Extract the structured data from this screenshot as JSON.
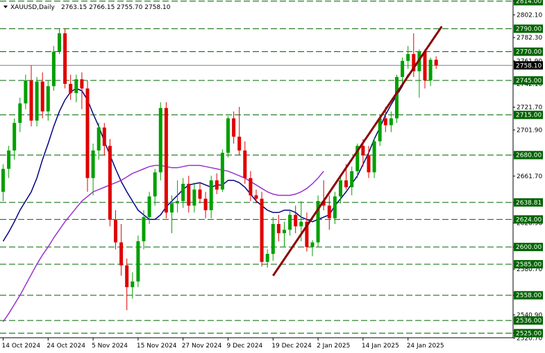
{
  "header": {
    "symbol_label": "XAUUSD,Daily",
    "ohlc_label": "2763.15 2766.15 2755.70 2758.10"
  },
  "chart_data": {
    "type": "candlestick",
    "symbol": "XAUUSD",
    "timeframe": "Daily",
    "ylim": [
      2521,
      2815
    ],
    "grid": false,
    "colors": {
      "bull": "#00a000",
      "bear": "#e00000",
      "ma_fast": "#000080",
      "ma_slow": "#9932cc",
      "trendline": "#8b0000",
      "level_line": "#006400",
      "price_line": "#708090",
      "level_label_bg": "#006400",
      "price_label_bg": "#000000"
    },
    "y_ticks": [
      "2814.00",
      "2802.10",
      "2782.30",
      "2761.90",
      "2742.10",
      "2721.70",
      "2701.90",
      "2680.00",
      "2661.70",
      "2638.81",
      "2620.90",
      "2600.00",
      "2580.70",
      "2558.00",
      "2540.90",
      "2525.00",
      "2520.70"
    ],
    "levels": [
      2814.0,
      2790.0,
      2770.0,
      2745.0,
      2715.0,
      2680.0,
      2638.81,
      2624.0,
      2600.0,
      2585.0,
      2558.0,
      2536.0,
      2525.0
    ],
    "level_labels": [
      "2814.00",
      "2790.00",
      "2770.00",
      "2745.00",
      "2715.00",
      "2680.00",
      "2638.81",
      "2624.00",
      "2600.00",
      "2585.00",
      "2558.00",
      "2536.00",
      "2525.00"
    ],
    "current_price": 2758.1,
    "current_price_label": "2758.10",
    "x_labels": [
      "14 Oct 2024",
      "24 Oct 2024",
      "5 Nov 2024",
      "15 Nov 2024",
      "27 Nov 2024",
      "9 Dec 2024",
      "19 Dec 2024",
      "2 Jan 2025",
      "14 Jan 2025",
      "24 Jan 2025"
    ],
    "x_label_index": [
      0,
      8,
      16,
      24,
      32,
      40,
      48,
      56,
      64,
      72
    ],
    "candles": [
      {
        "o": 2648,
        "h": 2672,
        "l": 2640,
        "c": 2668
      },
      {
        "o": 2668,
        "h": 2688,
        "l": 2660,
        "c": 2684
      },
      {
        "o": 2684,
        "h": 2712,
        "l": 2676,
        "c": 2708
      },
      {
        "o": 2708,
        "h": 2730,
        "l": 2700,
        "c": 2725
      },
      {
        "o": 2725,
        "h": 2750,
        "l": 2720,
        "c": 2745
      },
      {
        "o": 2745,
        "h": 2758,
        "l": 2705,
        "c": 2710
      },
      {
        "o": 2710,
        "h": 2748,
        "l": 2705,
        "c": 2744
      },
      {
        "o": 2744,
        "h": 2752,
        "l": 2712,
        "c": 2718
      },
      {
        "o": 2718,
        "h": 2745,
        "l": 2710,
        "c": 2740
      },
      {
        "o": 2740,
        "h": 2775,
        "l": 2736,
        "c": 2770
      },
      {
        "o": 2770,
        "h": 2790,
        "l": 2768,
        "c": 2786
      },
      {
        "o": 2786,
        "h": 2790,
        "l": 2738,
        "c": 2742
      },
      {
        "o": 2742,
        "h": 2750,
        "l": 2728,
        "c": 2734
      },
      {
        "o": 2734,
        "h": 2750,
        "l": 2726,
        "c": 2746
      },
      {
        "o": 2746,
        "h": 2752,
        "l": 2720,
        "c": 2738
      },
      {
        "o": 2738,
        "h": 2745,
        "l": 2648,
        "c": 2660
      },
      {
        "o": 2660,
        "h": 2690,
        "l": 2645,
        "c": 2684
      },
      {
        "o": 2684,
        "h": 2708,
        "l": 2676,
        "c": 2704
      },
      {
        "o": 2704,
        "h": 2708,
        "l": 2680,
        "c": 2688
      },
      {
        "o": 2688,
        "h": 2694,
        "l": 2618,
        "c": 2624
      },
      {
        "o": 2624,
        "h": 2632,
        "l": 2598,
        "c": 2604
      },
      {
        "o": 2604,
        "h": 2620,
        "l": 2575,
        "c": 2584
      },
      {
        "o": 2584,
        "h": 2590,
        "l": 2545,
        "c": 2565
      },
      {
        "o": 2565,
        "h": 2578,
        "l": 2555,
        "c": 2570
      },
      {
        "o": 2570,
        "h": 2610,
        "l": 2565,
        "c": 2605
      },
      {
        "o": 2605,
        "h": 2632,
        "l": 2598,
        "c": 2626
      },
      {
        "o": 2626,
        "h": 2648,
        "l": 2620,
        "c": 2644
      },
      {
        "o": 2644,
        "h": 2668,
        "l": 2636,
        "c": 2665
      },
      {
        "o": 2665,
        "h": 2726,
        "l": 2658,
        "c": 2721
      },
      {
        "o": 2721,
        "h": 2726,
        "l": 2625,
        "c": 2630
      },
      {
        "o": 2630,
        "h": 2645,
        "l": 2612,
        "c": 2638
      },
      {
        "o": 2638,
        "h": 2658,
        "l": 2630,
        "c": 2640
      },
      {
        "o": 2640,
        "h": 2660,
        "l": 2634,
        "c": 2655
      },
      {
        "o": 2655,
        "h": 2662,
        "l": 2630,
        "c": 2636
      },
      {
        "o": 2636,
        "h": 2656,
        "l": 2630,
        "c": 2650
      },
      {
        "o": 2650,
        "h": 2656,
        "l": 2638,
        "c": 2642
      },
      {
        "o": 2642,
        "h": 2648,
        "l": 2625,
        "c": 2632
      },
      {
        "o": 2632,
        "h": 2662,
        "l": 2625,
        "c": 2658
      },
      {
        "o": 2658,
        "h": 2664,
        "l": 2646,
        "c": 2650
      },
      {
        "o": 2650,
        "h": 2685,
        "l": 2648,
        "c": 2682
      },
      {
        "o": 2682,
        "h": 2714,
        "l": 2678,
        "c": 2712
      },
      {
        "o": 2712,
        "h": 2718,
        "l": 2690,
        "c": 2696
      },
      {
        "o": 2696,
        "h": 2722,
        "l": 2680,
        "c": 2684
      },
      {
        "o": 2684,
        "h": 2692,
        "l": 2655,
        "c": 2660
      },
      {
        "o": 2660,
        "h": 2666,
        "l": 2640,
        "c": 2645
      },
      {
        "o": 2645,
        "h": 2650,
        "l": 2638,
        "c": 2642
      },
      {
        "o": 2642,
        "h": 2648,
        "l": 2583,
        "c": 2587
      },
      {
        "o": 2587,
        "h": 2598,
        "l": 2582,
        "c": 2594
      },
      {
        "o": 2594,
        "h": 2626,
        "l": 2588,
        "c": 2620
      },
      {
        "o": 2620,
        "h": 2628,
        "l": 2605,
        "c": 2612
      },
      {
        "o": 2612,
        "h": 2622,
        "l": 2600,
        "c": 2615
      },
      {
        "o": 2615,
        "h": 2632,
        "l": 2610,
        "c": 2628
      },
      {
        "o": 2628,
        "h": 2636,
        "l": 2612,
        "c": 2618
      },
      {
        "o": 2618,
        "h": 2640,
        "l": 2605,
        "c": 2622
      },
      {
        "o": 2622,
        "h": 2630,
        "l": 2596,
        "c": 2600
      },
      {
        "o": 2600,
        "h": 2606,
        "l": 2592,
        "c": 2604
      },
      {
        "o": 2604,
        "h": 2645,
        "l": 2600,
        "c": 2640
      },
      {
        "o": 2640,
        "h": 2658,
        "l": 2632,
        "c": 2636
      },
      {
        "o": 2636,
        "h": 2645,
        "l": 2615,
        "c": 2625
      },
      {
        "o": 2625,
        "h": 2648,
        "l": 2620,
        "c": 2644
      },
      {
        "o": 2644,
        "h": 2662,
        "l": 2638,
        "c": 2658
      },
      {
        "o": 2658,
        "h": 2672,
        "l": 2650,
        "c": 2652
      },
      {
        "o": 2652,
        "h": 2670,
        "l": 2645,
        "c": 2666
      },
      {
        "o": 2666,
        "h": 2690,
        "l": 2660,
        "c": 2688
      },
      {
        "o": 2688,
        "h": 2694,
        "l": 2670,
        "c": 2680
      },
      {
        "o": 2680,
        "h": 2688,
        "l": 2660,
        "c": 2665
      },
      {
        "o": 2665,
        "h": 2695,
        "l": 2660,
        "c": 2692
      },
      {
        "o": 2692,
        "h": 2715,
        "l": 2688,
        "c": 2712
      },
      {
        "o": 2712,
        "h": 2722,
        "l": 2700,
        "c": 2706
      },
      {
        "o": 2706,
        "h": 2718,
        "l": 2700,
        "c": 2712
      },
      {
        "o": 2712,
        "h": 2750,
        "l": 2708,
        "c": 2748
      },
      {
        "o": 2748,
        "h": 2765,
        "l": 2742,
        "c": 2762
      },
      {
        "o": 2762,
        "h": 2775,
        "l": 2755,
        "c": 2768
      },
      {
        "o": 2768,
        "h": 2786,
        "l": 2748,
        "c": 2753
      },
      {
        "o": 2753,
        "h": 2772,
        "l": 2730,
        "c": 2770
      },
      {
        "o": 2770,
        "h": 2772,
        "l": 2738,
        "c": 2745
      },
      {
        "o": 2745,
        "h": 2765,
        "l": 2740,
        "c": 2763
      },
      {
        "o": 2763,
        "h": 2766,
        "l": 2755,
        "c": 2758
      }
    ],
    "series": [
      {
        "type": "line",
        "style": "ma_fast",
        "values": [
          2605,
          2613,
          2622,
          2632,
          2640,
          2648,
          2660,
          2676,
          2690,
          2705,
          2718,
          2728,
          2735,
          2738,
          2736,
          2728,
          2716,
          2705,
          2692,
          2680,
          2668,
          2657,
          2648,
          2640,
          2632,
          2628,
          2624,
          2624,
          2628,
          2635,
          2640,
          2645,
          2650,
          2654,
          2655,
          2656,
          2654,
          2652,
          2654,
          2654,
          2658,
          2658,
          2656,
          2652,
          2646,
          2640,
          2636,
          2632,
          2630,
          2630,
          2632,
          2632,
          2630,
          2626,
          2624,
          2622,
          2624,
          2626,
          2628,
          2636,
          2642,
          2648,
          2655,
          2662,
          2672,
          2682,
          2694,
          2704,
          2715,
          2724,
          2732,
          2740,
          2750
        ]
      },
      {
        "type": "line",
        "style": "ma_slow",
        "values": [
          2535,
          2542,
          2550,
          2558,
          2567,
          2576,
          2585,
          2593,
          2600,
          2608,
          2615,
          2622,
          2628,
          2634,
          2640,
          2644,
          2648,
          2650,
          2652,
          2654,
          2656,
          2658,
          2661,
          2664,
          2666,
          2668,
          2670,
          2671,
          2671,
          2670,
          2669,
          2669,
          2670,
          2671,
          2671,
          2671,
          2670,
          2669,
          2668,
          2667,
          2666,
          2664,
          2662,
          2660,
          2657,
          2654,
          2651,
          2648,
          2646,
          2645,
          2645,
          2645,
          2646,
          2648,
          2651,
          2655,
          2660,
          2666
        ]
      }
    ],
    "trendline": {
      "start": {
        "index": 48,
        "price": 2575
      },
      "end": {
        "index": 78,
        "price": 2792
      }
    }
  }
}
